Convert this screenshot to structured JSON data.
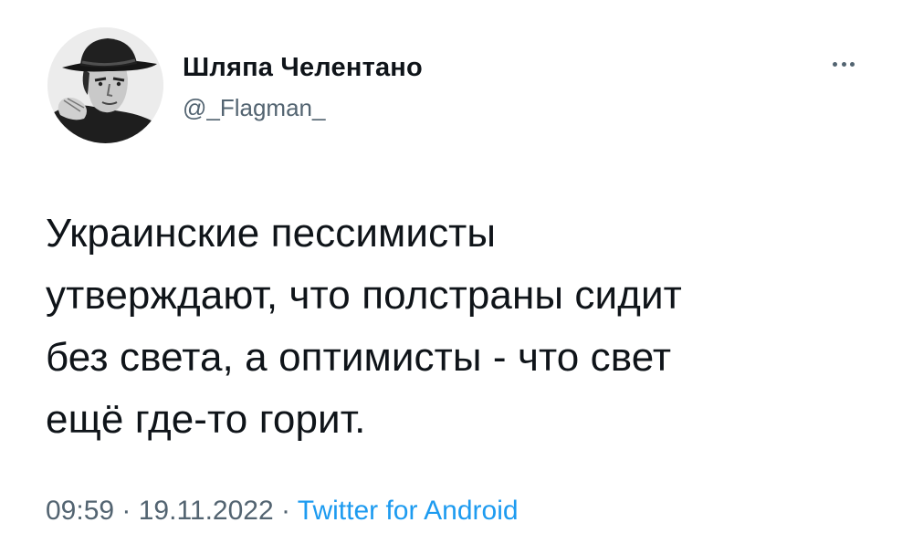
{
  "author": {
    "display_name": "Шляпа Челентано",
    "handle": "@_Flagman_",
    "avatar_icon": "portrait-in-hat-avatar"
  },
  "tweet": {
    "text": "Украинские пессимисты\nутверждают, что полстраны сидит\nбез света, а оптимисты - что свет\nещё где-то горит."
  },
  "meta": {
    "time": "09:59",
    "separator1": " · ",
    "date": "19.11.2022",
    "separator2": " · ",
    "source": "Twitter for Android"
  },
  "actions": {
    "more_icon": "more-horizontal-icon"
  },
  "colors": {
    "text": "#0f1419",
    "secondary": "#536471",
    "link": "#1d9bf0",
    "background": "#ffffff"
  }
}
